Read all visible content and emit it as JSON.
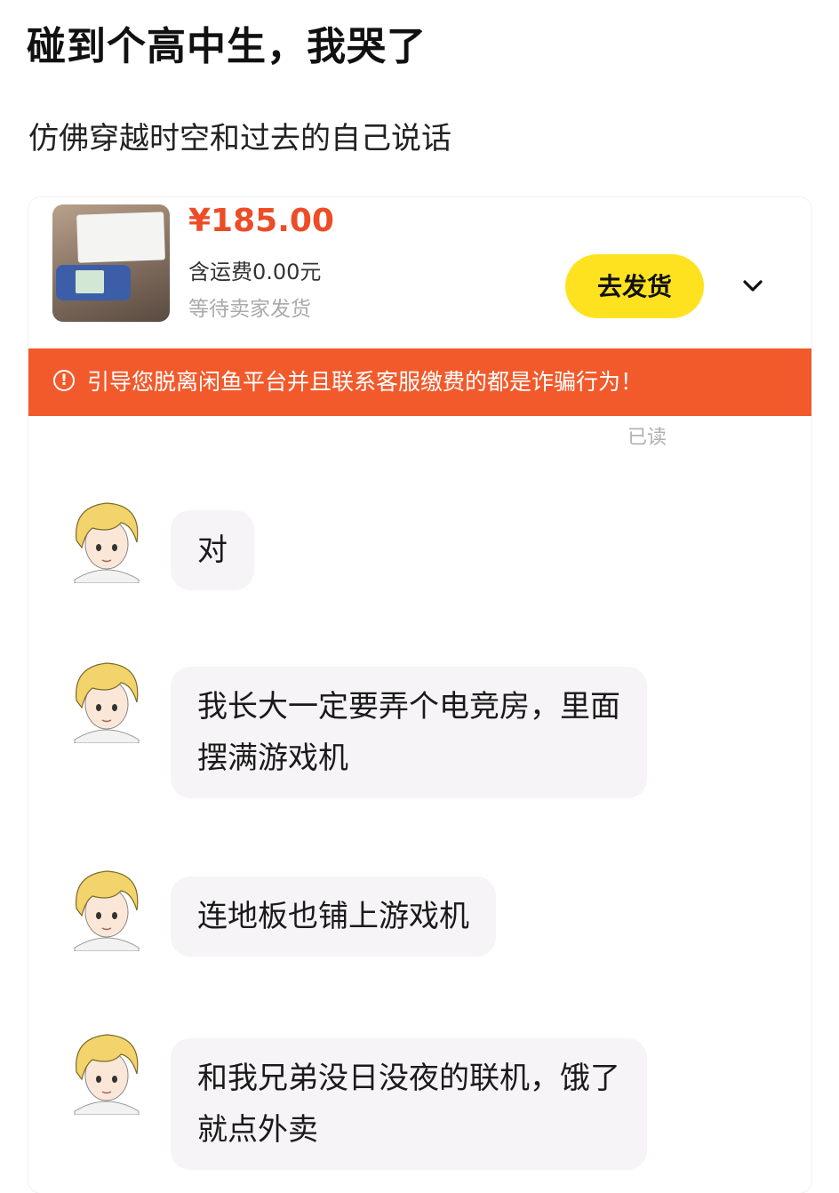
{
  "post": {
    "title": "碰到个高中生，我哭了",
    "subtitle": "仿佛穿越时空和过去的自己说话"
  },
  "order": {
    "price": "¥185.00",
    "shipping": "含运费0.00元",
    "status": "等待卖家发货",
    "ship_button": "去发货",
    "expand_icon": "chevron-down-icon"
  },
  "warning": {
    "icon": "info-circle-icon",
    "text": "引导您脱离闲鱼平台并且联系客服缴费的都是诈骗行为！"
  },
  "read_receipt": "已读",
  "messages": [
    {
      "lines": [
        "对"
      ]
    },
    {
      "lines": [
        "我长大一定要弄个电竞房，里面",
        "摆满游戏机"
      ]
    },
    {
      "lines": [
        "连地板也铺上游戏机"
      ]
    },
    {
      "lines": [
        "和我兄弟没日没夜的联机，饿了",
        "就点外卖"
      ]
    }
  ],
  "colors": {
    "price": "#ec4d27",
    "warning_bg": "#f25a2c",
    "ship_button_bg": "#ffe21f",
    "bubble_bg": "#f6f4f6",
    "avatar_hair": "#f3d36b"
  }
}
